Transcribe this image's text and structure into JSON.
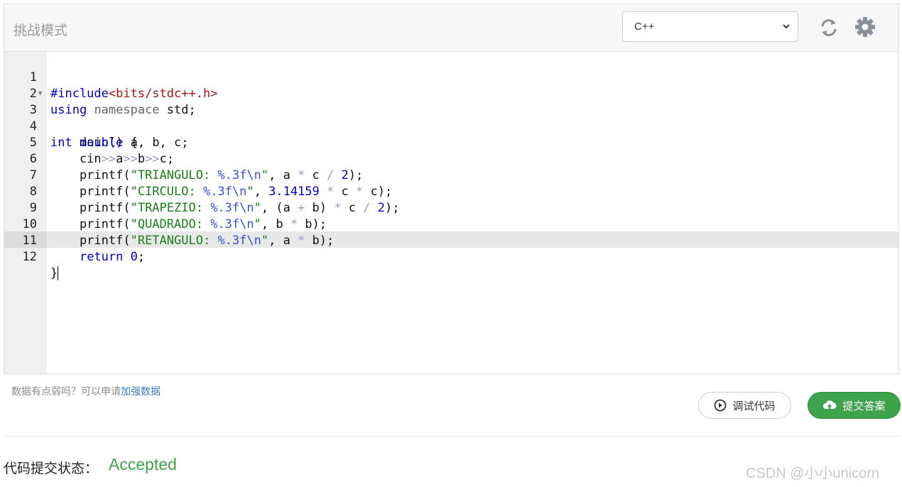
{
  "header": {
    "title": "挑战模式",
    "language": "C++",
    "refresh_icon": "refresh-icon",
    "settings_icon": "gear-icon"
  },
  "editor": {
    "active_line": 12,
    "lines": [
      {
        "n": "1"
      },
      {
        "n": "2"
      },
      {
        "n": "3"
      },
      {
        "n": "4"
      },
      {
        "n": "5"
      },
      {
        "n": "6"
      },
      {
        "n": "7"
      },
      {
        "n": "8"
      },
      {
        "n": "9"
      },
      {
        "n": "10"
      },
      {
        "n": "11"
      },
      {
        "n": "12"
      }
    ],
    "code": [
      "#include<bits/stdc++.h>",
      "using namespace std;",
      "int main() {",
      "    double a, b, c;",
      "    cin>>a>>b>>c;",
      "    printf(\"TRIANGULO: %.3f\\n\", a * c / 2);",
      "    printf(\"CIRCULO: %.3f\\n\", 3.14159 * c * c);",
      "    printf(\"TRAPEZIO: %.3f\\n\", (a + b) * c / 2);",
      "    printf(\"QUADRADO: %.3f\\n\", b * b);",
      "    printf(\"RETANGULO: %.3f\\n\", a * b);",
      "    return 0;",
      "}"
    ]
  },
  "footer": {
    "hint_text": "数据有点弱吗？可以申请",
    "hint_link": "加强数据",
    "debug_label": "调试代码",
    "submit_label": "提交答案",
    "status_label": "代码提交状态：",
    "status_value": "Accepted",
    "status_color": "#3fa34d"
  },
  "watermark": "CSDN @小小unicorn"
}
